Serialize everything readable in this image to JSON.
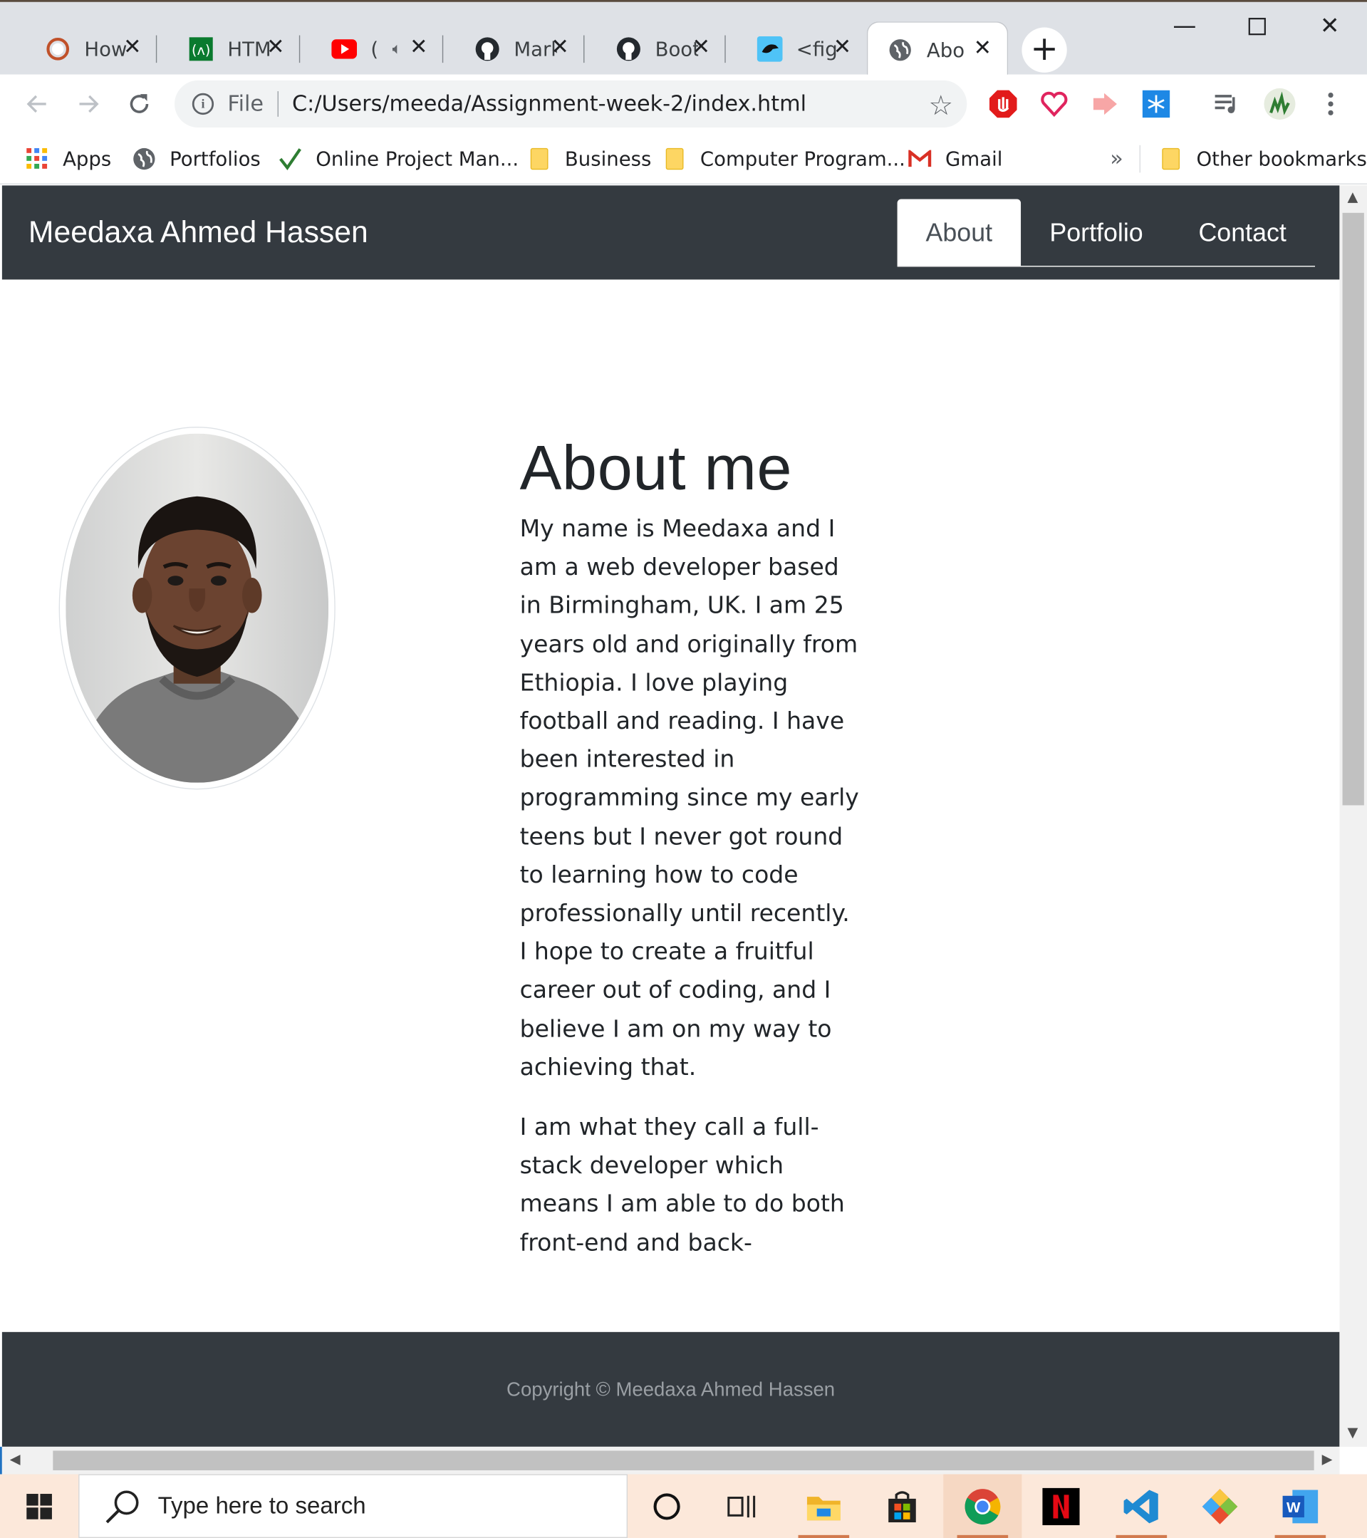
{
  "browser": {
    "tabs": [
      {
        "title": "How",
        "icon": "ring-icon"
      },
      {
        "title": "HTM",
        "icon": "freecodecamp-icon"
      },
      {
        "title": "(",
        "icon": "youtube-icon"
      },
      {
        "title": "Mark",
        "icon": "github-icon"
      },
      {
        "title": "Boot",
        "icon": "github-icon"
      },
      {
        "title": "<fig",
        "icon": "bird-icon"
      },
      {
        "title": "Abo",
        "icon": "globe-icon"
      }
    ],
    "new_tab_label": "+",
    "file_label": "File",
    "url": "C:/Users/meeda/Assignment-week-2/index.html",
    "bookmarks": [
      {
        "label": "Apps",
        "icon": "apps-grid-icon"
      },
      {
        "label": "Portfolios",
        "icon": "globe-icon"
      },
      {
        "label": "Online Project Man...",
        "icon": "checkmark-icon"
      },
      {
        "label": "Business",
        "icon": "folder-icon"
      },
      {
        "label": "Computer Program...",
        "icon": "folder-icon"
      },
      {
        "label": "Gmail",
        "icon": "gmail-icon"
      }
    ],
    "overflow_label": "»",
    "other_bookmarks": "Other bookmarks"
  },
  "page": {
    "brand": "Meedaxa Ahmed Hassen",
    "nav": [
      "About",
      "Portfolio",
      "Contact"
    ],
    "active_nav": "About",
    "heading": "About me",
    "paragraphs": [
      "My name is Meedaxa and I am a web developer based in Birmingham, UK. I am 25 years old and originally from Ethiopia. I love playing football and reading. I have been interested in programming since my early teens but I never got round to learning how to code professionally until recently. I hope to create a fruitful career out of coding, and I believe I am on my way to achieving that.",
      "I am what they call a full-stack developer which means I am able to do both front-end and back-"
    ],
    "footer": "Copyright © Meedaxa Ahmed Hassen"
  },
  "taskbar": {
    "search_placeholder": "Type here to search",
    "apps": [
      "cortana-icon",
      "task-view-icon",
      "file-explorer-icon",
      "store-icon",
      "chrome-icon",
      "netflix-icon",
      "vscode-icon",
      "git-icon",
      "word-icon"
    ]
  },
  "colors": {
    "navbar": "#343a40",
    "taskbar": "#fce8da",
    "tabstrip": "#dee1e6"
  }
}
